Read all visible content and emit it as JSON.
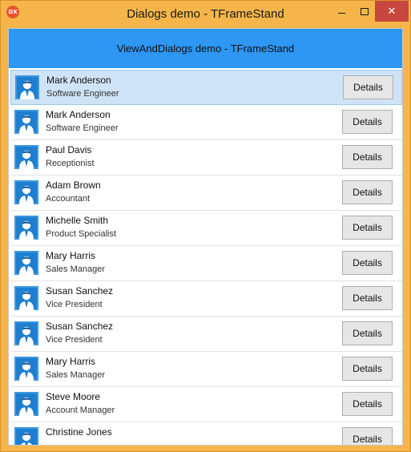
{
  "window": {
    "title": "Dialogs demo - TFrameStand",
    "app_icon_text": "DX",
    "close_glyph": "✕"
  },
  "header": {
    "title": "ViewAndDialogs demo - TFrameStand"
  },
  "people": [
    {
      "name": "Mark Anderson",
      "role": "Software Engineer",
      "button": "Details",
      "selected": true
    },
    {
      "name": "Mark Anderson",
      "role": "Software Engineer",
      "button": "Details"
    },
    {
      "name": "Paul Davis",
      "role": "Receptionist",
      "button": "Details"
    },
    {
      "name": "Adam Brown",
      "role": "Accountant",
      "button": "Details"
    },
    {
      "name": "Michelle Smith",
      "role": "Product Specialist",
      "button": "Details"
    },
    {
      "name": "Mary Harris",
      "role": "Sales Manager",
      "button": "Details"
    },
    {
      "name": "Susan Sanchez",
      "role": "Vice President",
      "button": "Details"
    },
    {
      "name": "Susan Sanchez",
      "role": "Vice President",
      "button": "Details"
    },
    {
      "name": "Mary Harris",
      "role": "Sales Manager",
      "button": "Details"
    },
    {
      "name": "Steve Moore",
      "role": "Account Manager",
      "button": "Details"
    },
    {
      "name": "Christine Jones",
      "role": "",
      "button": "Details"
    }
  ],
  "icons": {
    "avatar": "person-avatar-icon"
  },
  "colors": {
    "frame": "#f5b54a",
    "header": "#2e96f3",
    "close": "#c7463d",
    "avatar_blue": "#1e7fd1"
  }
}
